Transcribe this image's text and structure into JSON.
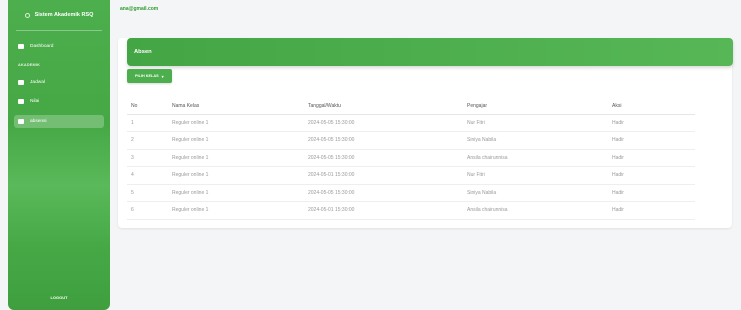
{
  "sidebar": {
    "brand": "Sistem Akademik RSQ",
    "items": [
      {
        "label": "Dashboard",
        "icon": "dashboard-icon"
      },
      {
        "label": "Jadwal",
        "icon": "person-icon"
      },
      {
        "label": "Nilai",
        "icon": "document-icon"
      },
      {
        "label": "absensi",
        "icon": "absensi-icon"
      }
    ],
    "section": "AKADEMIK",
    "logout": "LOGOUT"
  },
  "topbar": {
    "email": "ana@gmail.com"
  },
  "card": {
    "title": "Absen",
    "pilih_button": "PILIH KELAS",
    "columns": [
      "No",
      "Nama Kelas",
      "Tanggal/Waktu",
      "Pengajar",
      "Aksi"
    ],
    "rows": [
      {
        "no": "1",
        "kelas": "Reguler online 1",
        "waktu": "2024-05-05 15:30:00",
        "pengajar": "Nur Fitri",
        "aksi": "Hadir"
      },
      {
        "no": "2",
        "kelas": "Reguler online 1",
        "waktu": "2024-05-05 15:30:00",
        "pengajar": "Siniya Nabila",
        "aksi": "Hadir"
      },
      {
        "no": "3",
        "kelas": "Reguler online 1",
        "waktu": "2024-05-05 15:30:00",
        "pengajar": "Ansila chairunnisa",
        "aksi": "Hadir"
      },
      {
        "no": "4",
        "kelas": "Reguler online 1",
        "waktu": "2024-05-01 15:30:00",
        "pengajar": "Nur Fitri",
        "aksi": "Hadir"
      },
      {
        "no": "5",
        "kelas": "Reguler online 1",
        "waktu": "2024-05-05 15:30:00",
        "pengajar": "Siniya Nabila",
        "aksi": "Hadir"
      },
      {
        "no": "6",
        "kelas": "Reguler online 1",
        "waktu": "2024-05-01 15:30:00",
        "pengajar": "Ansila chairunnisa",
        "aksi": "Hadir"
      }
    ]
  },
  "colors": {
    "accent": "#4cae4c",
    "email": "#2f9a2f"
  }
}
